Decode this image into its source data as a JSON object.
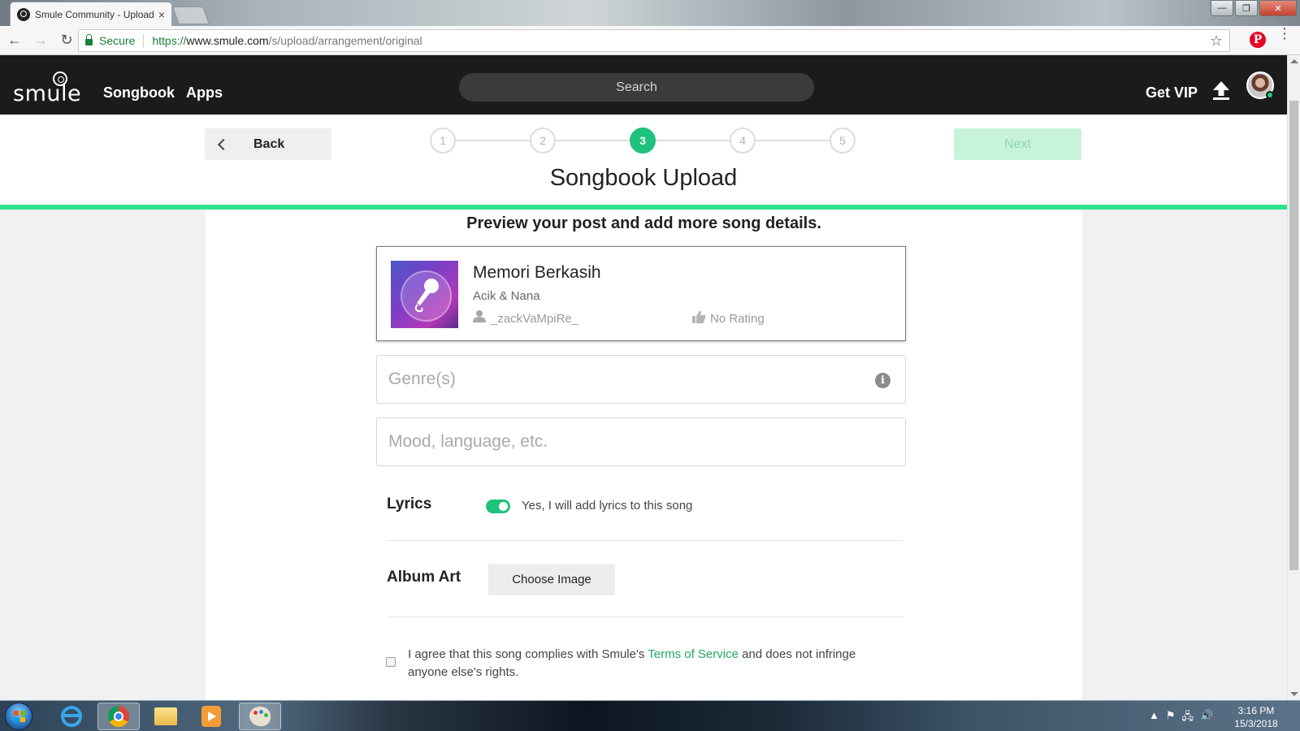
{
  "browser": {
    "tab_title": "Smule Community - Upload",
    "tab_close": "×",
    "secure_label": "Secure",
    "url_scheme": "https://",
    "url_host": "www.smule.com",
    "url_path": "/s/upload/arrangement/original",
    "back_icon": "←",
    "forward_icon": "→",
    "reload_icon": "↻",
    "star_icon": "☆",
    "pinterest_icon": "P",
    "menu_icon": "⋮",
    "win_minimize": "—",
    "win_maximize": "❐",
    "win_close": "✕"
  },
  "header": {
    "logo_text": "smule",
    "nav": {
      "songbook": "Songbook",
      "apps": "Apps"
    },
    "search_placeholder": "Search",
    "get_vip": "Get VIP"
  },
  "stepper": {
    "back_label": "Back",
    "next_label": "Next",
    "steps": [
      "1",
      "2",
      "3",
      "4",
      "5"
    ],
    "active_step": 3,
    "title": "Songbook Upload"
  },
  "form": {
    "subtitle": "Preview your post and add more song details.",
    "song": {
      "title": "Memori Berkasih",
      "artist": "Acik & Nana",
      "user": "_zackVaMpiRe_",
      "rating": "No Rating"
    },
    "genre_placeholder": "Genre(s)",
    "info_icon": "i",
    "mood_placeholder": "Mood, language, etc.",
    "lyrics_label": "Lyrics",
    "lyrics_toggle_text": "Yes, I will add lyrics to this song",
    "album_art_label": "Album Art",
    "choose_image": "Choose Image",
    "agree_prefix": "I agree that this song complies with Smule's ",
    "agree_link": "Terms of Service",
    "agree_suffix": " and does not infringe anyone else's rights."
  },
  "taskbar": {
    "clock_time": "3:16 PM",
    "clock_date": "15/3/2018",
    "tray_up": "▲",
    "tray_flag": "⚑",
    "tray_network": "🖧",
    "tray_volume": "🔊"
  },
  "colors": {
    "accent": "#1ec27a",
    "progress": "#2ee38e",
    "header_bg": "#1b1b1b",
    "link": "#1ea862"
  }
}
